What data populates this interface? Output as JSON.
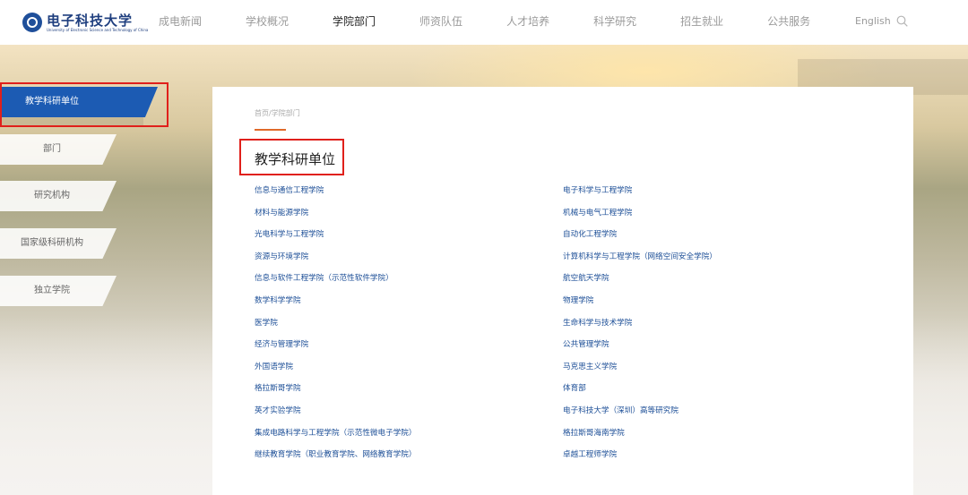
{
  "header": {
    "logo_text": "电子科技大学",
    "logo_subtext": "University of Electronic Science and Technology of China",
    "nav": [
      "成电新闻",
      "学校概况",
      "学院部门",
      "师资队伍",
      "人才培养",
      "科学研究",
      "招生就业",
      "公共服务"
    ],
    "active_nav": "学院部门",
    "language": "English",
    "search_icon": "search-icon"
  },
  "sidebar": {
    "items": [
      {
        "label": "教学科研单位",
        "active": true
      },
      {
        "label": "部门"
      },
      {
        "label": "研究机构"
      },
      {
        "label": "国家级科研机构"
      },
      {
        "label": "独立学院"
      }
    ]
  },
  "content": {
    "breadcrumb": "首页/学院部门",
    "title": "教学科研单位",
    "left_links": [
      "信息与通信工程学院",
      "材料与能源学院",
      "光电科学与工程学院",
      "资源与环境学院",
      "信息与软件工程学院（示范性软件学院）",
      "数学科学学院",
      "医学院",
      "经济与管理学院",
      "外国语学院",
      "格拉斯哥学院",
      "英才实验学院",
      "集成电路科学与工程学院（示范性微电子学院）",
      "继续教育学院（职业教育学院、网络教育学院）"
    ],
    "right_links": [
      "电子科学与工程学院",
      "机械与电气工程学院",
      "自动化工程学院",
      "计算机科学与工程学院（网络空间安全学院）",
      "航空航天学院",
      "物理学院",
      "生命科学与技术学院",
      "公共管理学院",
      "马克思主义学院",
      "体育部",
      "电子科技大学（深圳）高等研究院",
      "格拉斯哥海南学院",
      "卓越工程师学院"
    ]
  },
  "colors": {
    "brand_blue": "#1c5bb3",
    "link_blue": "#1d4f97",
    "highlight_red": "#e0201b",
    "accent_orange": "#e06a2a"
  }
}
